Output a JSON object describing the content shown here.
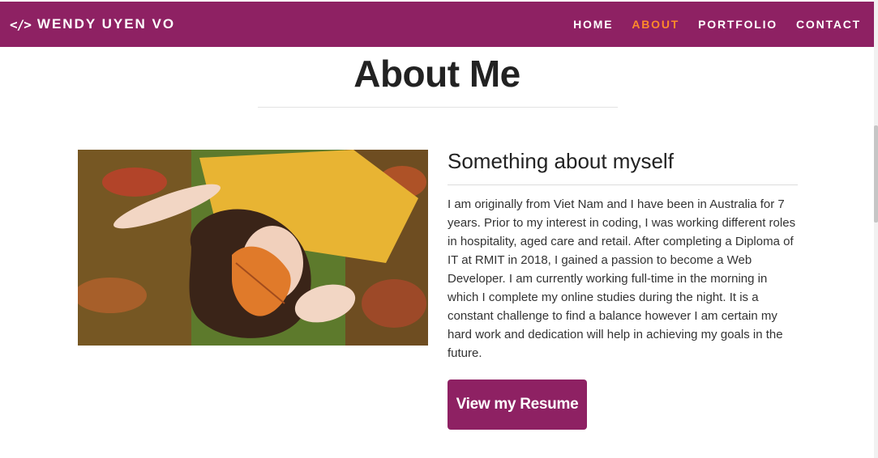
{
  "navbar": {
    "brand_icon": "</>",
    "brand_name": "WENDY UYEN VO",
    "links": [
      {
        "label": "HOME"
      },
      {
        "label": "ABOUT"
      },
      {
        "label": "PORTFOLIO"
      },
      {
        "label": "CONTACT"
      }
    ],
    "active": "ABOUT",
    "background_color": "#8e2163",
    "active_color": "#ff8a2a"
  },
  "main": {
    "title": "About Me",
    "photo_icon": "profile-photo",
    "section_heading": "Something about myself",
    "bio": "I am originally from Viet Nam and I have been in Australia for 7 years. Prior to my interest in coding, I was working different roles in hospitality, aged care and retail. After completing a Diploma of IT at RMIT in 2018, I gained a passion to become a Web Developer. I am currently working full-time in the morning in which I complete my online studies during the night. It is a constant challenge to find a balance however I am certain my hard work and dedication will help in achieving my goals in the future.",
    "resume_button": "View my Resume",
    "button_color": "#8e2163"
  }
}
